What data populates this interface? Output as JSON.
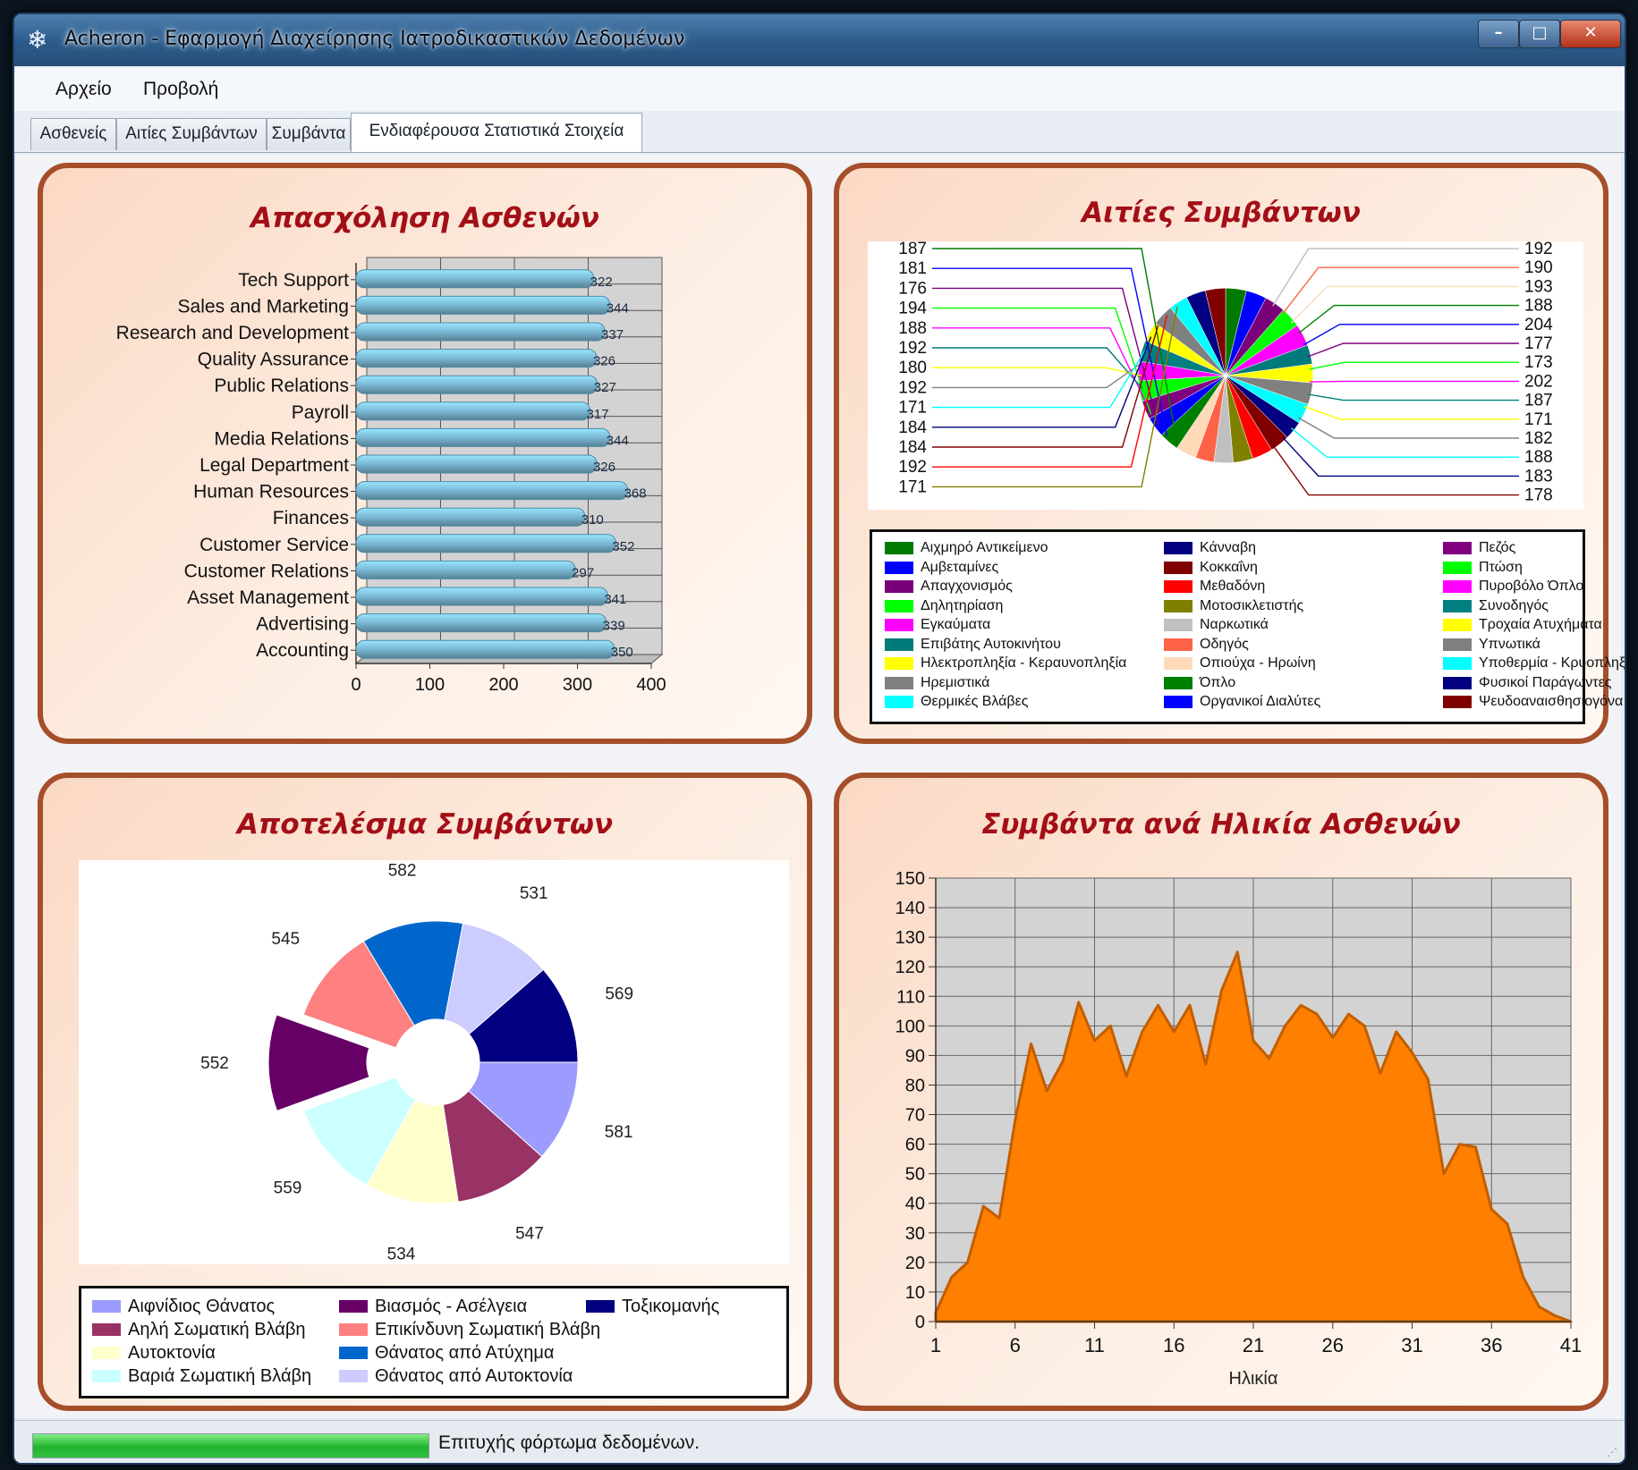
{
  "window": {
    "title": "Acheron - Εφαρμογή Διαχείρησης Ιατροδικαστικών Δεδομένων",
    "min": "–",
    "max": "□",
    "close": "✕",
    "icon": "snowflake-icon"
  },
  "menu": [
    "Αρχείο",
    "Προβολή"
  ],
  "tabs": [
    "Ασθενείς",
    "Αιτίες Συμβάντων",
    "Συμβάντα",
    "Ενδιαφέρουσα Στατιστικά Στοιχεία"
  ],
  "active_tab": 3,
  "status": {
    "progress": 1.0,
    "text": "Επιτυχής φόρτωμα δεδομένων."
  },
  "chart_data": [
    {
      "type": "bar",
      "orientation": "horizontal",
      "title": "Απασχόληση Ασθενών",
      "categories": [
        "Tech Support",
        "Sales and Marketing",
        "Research and Development",
        "Quality Assurance",
        "Public Relations",
        "Payroll",
        "Media Relations",
        "Legal Department",
        "Human Resources",
        "Finances",
        "Customer Service",
        "Customer Relations",
        "Asset Management",
        "Advertising",
        "Accounting"
      ],
      "values": [
        322,
        344,
        337,
        326,
        327,
        317,
        344,
        326,
        368,
        310,
        352,
        297,
        341,
        339,
        350
      ],
      "xlim": [
        0,
        400
      ],
      "xticks": [
        0,
        100,
        200,
        300,
        400
      ],
      "grid": true,
      "bar_color": "#7ab8d4"
    },
    {
      "type": "pie",
      "title": "Αιτίες Συμβάντων",
      "categories": [
        "Αιχμηρό Αντικείμενο",
        "Αμβεταμίνες",
        "Απαγχονισμός",
        "Δηλητηρίαση",
        "Εγκαύματα",
        "Επιβάτης Αυτοκινήτου",
        "Ηλεκτροπληξία - Κεραυνοπληξία",
        "Ηρεμιστικά",
        "Θερμικές Βλάβες",
        "Κάνναβη",
        "Κοκκαΐνη",
        "Μεθαδόνη",
        "Μοτοσικλετιστής",
        "Ναρκωτικά",
        "Οδηγός",
        "Οπιούχα - Ηρωίνη",
        "Όπλο",
        "Οργανικοί Διαλύτες",
        "Πεζός",
        "Πτώση",
        "Πυροβόλο Όπλο",
        "Συνοδηγός",
        "Τροχαία Ατυχήματα",
        "Υπνωτικά",
        "Υποθερμία - Κρυοπληξία",
        "Φυσικοί Παράγωντες",
        "Ψευδοαναισθησιογόνα"
      ],
      "colors": [
        "#007a00",
        "#0000ff",
        "#7a007a",
        "#00ff00",
        "#ff00ff",
        "#007a7a",
        "#ffff00",
        "#808080",
        "#00ffff",
        "#000080",
        "#800000",
        "#ff0000",
        "#808000",
        "#c0c0c0",
        "#ff6347",
        "#ffdab9",
        "#008000",
        "#0000ff",
        "#800080",
        "#00ff00",
        "#ff00ff",
        "#008080",
        "#ffff00",
        "#808080",
        "#00ffff",
        "#000080",
        "#800000"
      ],
      "values": [
        192,
        190,
        193,
        188,
        204,
        177,
        173,
        202,
        187,
        171,
        182,
        188,
        183,
        178,
        171,
        192,
        184,
        184,
        171,
        192,
        180,
        192,
        188,
        194,
        176,
        181,
        187
      ],
      "label_values_left": [
        187,
        181,
        176,
        194,
        188,
        192,
        180,
        192,
        171,
        184,
        184,
        192,
        171
      ],
      "label_values_right": [
        192,
        190,
        193,
        188,
        204,
        177,
        173,
        202,
        187,
        171,
        182,
        188,
        183,
        178
      ],
      "legend": "bottom"
    },
    {
      "type": "pie",
      "variant": "doughnut",
      "title": "Αποτελέσμα Συμβάντων",
      "categories": [
        "Αιφνίδιος Θάνατος",
        "Αηλή Σωματική Βλάβη",
        "Αυτοκτονία",
        "Βαριά Σωματική Βλάβη",
        "Βιασμός - Ασέλγεια",
        "Επικίνδυνη Σωματική Βλάβη",
        "Θάνατος από Ατύχημα",
        "Θάνατος από Αυτοκτονία",
        "Τοξικομανής"
      ],
      "values": [
        581,
        547,
        534,
        559,
        552,
        545,
        582,
        531,
        569
      ],
      "colors": [
        "#9c9cff",
        "#993366",
        "#ffffcc",
        "#ccffff",
        "#660066",
        "#ff8080",
        "#0066cc",
        "#ccccff",
        "#000080"
      ],
      "exploded": "Βιασμός - Ασέλγεια",
      "legend": "bottom"
    },
    {
      "type": "area",
      "title": "Συμβάντα ανά Ηλικία Ασθενών",
      "xlabel": "Ηλικία",
      "ylabel": "",
      "x": [
        1,
        2,
        3,
        4,
        5,
        6,
        7,
        8,
        9,
        10,
        11,
        12,
        13,
        14,
        15,
        16,
        17,
        18,
        19,
        20,
        21,
        22,
        23,
        24,
        25,
        26,
        27,
        28,
        29,
        30,
        31,
        32,
        33,
        34,
        35,
        36,
        37,
        38,
        39,
        40,
        41
      ],
      "values": [
        3,
        15,
        20,
        39,
        35,
        68,
        94,
        78,
        88,
        108,
        95,
        100,
        83,
        98,
        107,
        98,
        107,
        87,
        112,
        125,
        95,
        89,
        100,
        107,
        104,
        96,
        104,
        100,
        84,
        98,
        91,
        82,
        50,
        60,
        59,
        38,
        33,
        15,
        5,
        2,
        0
      ],
      "xticks": [
        1,
        6,
        11,
        16,
        21,
        26,
        31,
        36,
        41
      ],
      "yticks": [
        0,
        10,
        20,
        30,
        40,
        50,
        60,
        70,
        80,
        90,
        100,
        110,
        120,
        130,
        140,
        150
      ],
      "ylim": [
        0,
        150
      ],
      "grid": true,
      "color": "#ff7f00"
    }
  ]
}
